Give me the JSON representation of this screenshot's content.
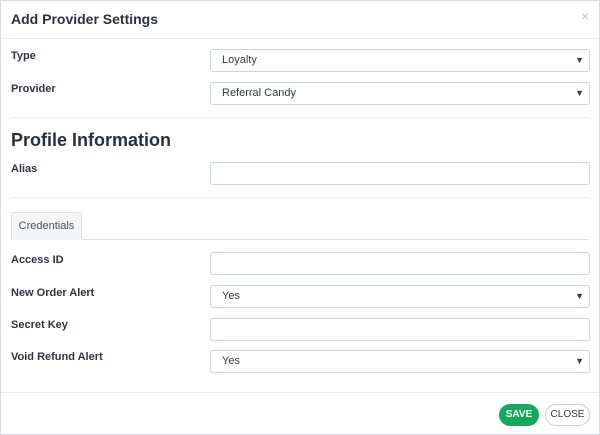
{
  "dialog": {
    "title": "Add Provider Settings",
    "close_glyph": "×"
  },
  "fields": {
    "type": {
      "label": "Type",
      "value": "Loyalty"
    },
    "provider": {
      "label": "Provider",
      "value": "Referral Candy"
    },
    "alias": {
      "label": "Alias",
      "value": ""
    }
  },
  "profile": {
    "heading": "Profile Information"
  },
  "tabs": [
    {
      "label": "Credentials",
      "active": true
    }
  ],
  "credentials": {
    "access_id": {
      "label": "Access ID",
      "value": ""
    },
    "new_order_alert": {
      "label": "New Order Alert",
      "value": "Yes"
    },
    "secret_key": {
      "label": "Secret Key",
      "value": ""
    },
    "void_refund_alert": {
      "label": "Void Refund Alert",
      "value": "Yes"
    }
  },
  "footer": {
    "save_label": "SAVE",
    "close_label": "CLOSE"
  },
  "colors": {
    "save_button": "#14a85a",
    "title_text": "#2a3140"
  },
  "icons": {
    "close": "close-icon",
    "dropdown": "chevron-down-icon"
  }
}
